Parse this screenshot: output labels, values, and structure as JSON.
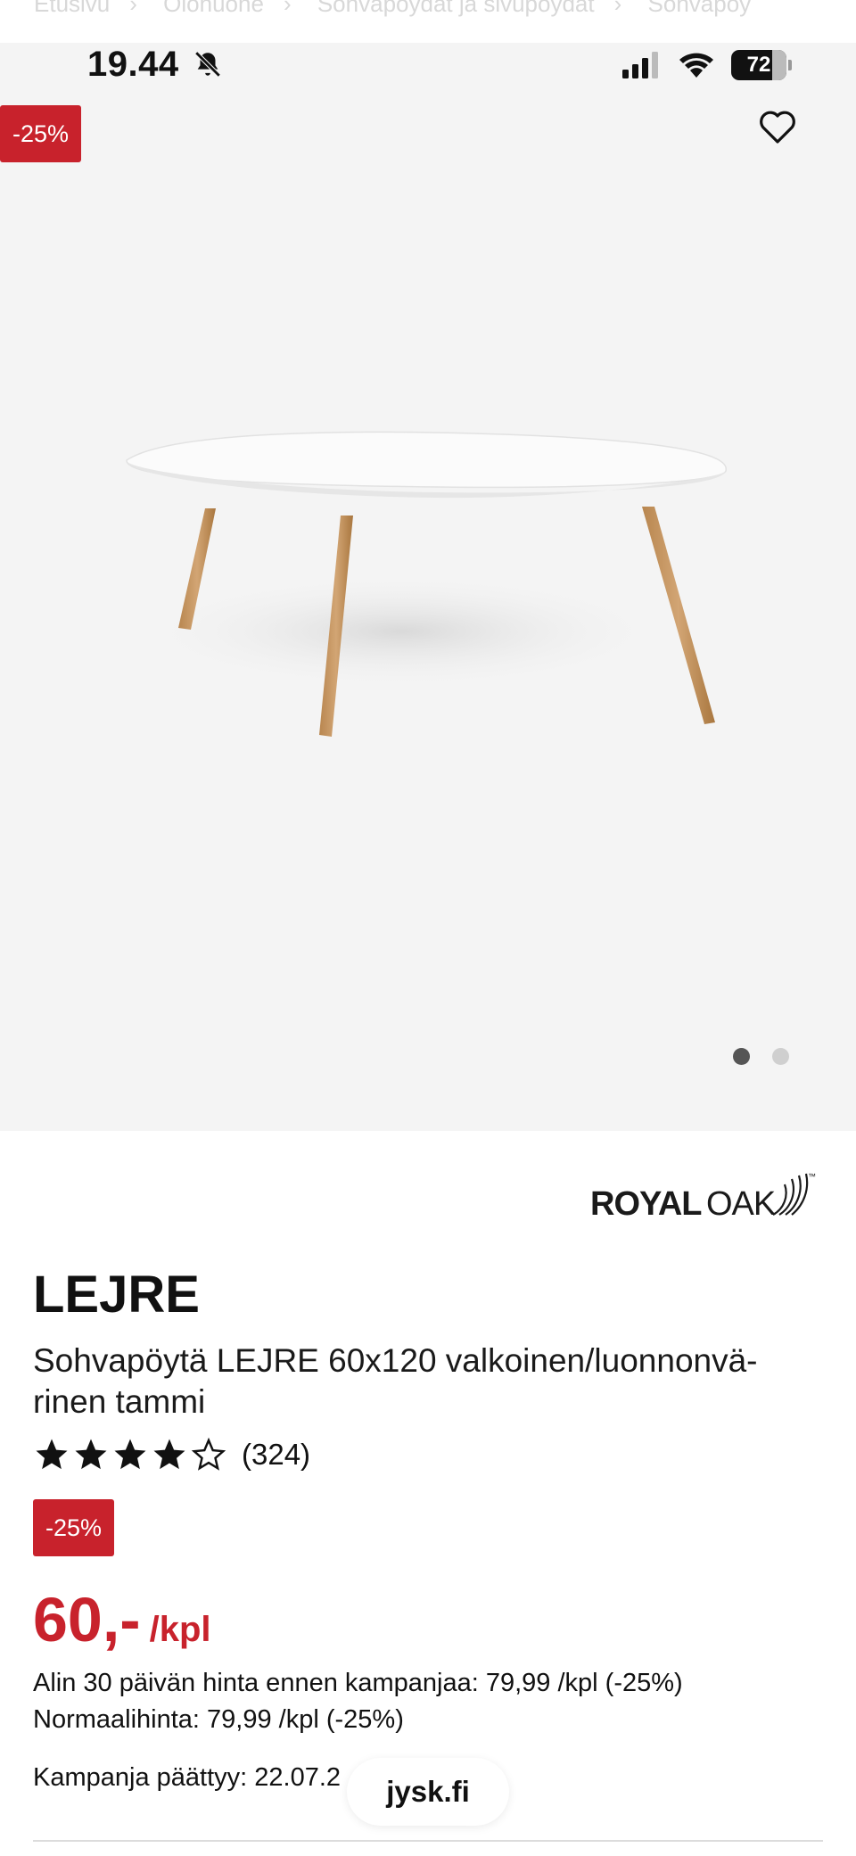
{
  "breadcrumb": [
    "Etusivu",
    "Olohuone",
    "Sohvapöydät ja sivupöydät",
    "Sohvapöy"
  ],
  "status_bar": {
    "time": "19.44",
    "battery": "72"
  },
  "gallery": {
    "discount_badge": "-25%",
    "slides_total": 2,
    "active_slide": 1
  },
  "brand": {
    "name": "ROYAL",
    "name2": "OAK",
    "tm": "™"
  },
  "product": {
    "name": "LEJRE",
    "description": "Sohvapöytä LEJRE 60x120 valkoinen/luonnonvä-rinen tammi",
    "rating": 4,
    "rating_max": 5,
    "rating_count": "(324)",
    "discount_badge": "-25%",
    "price": "60,-",
    "price_unit": "/kpl",
    "lowest_price_30d": "Alin 30 päivän hinta ennen kampanjaa: 79,99 /kpl (-25%)",
    "normal_price": "Normaalihinta: 79,99 /kpl (-25%)",
    "campaign_end": "Kampanja päättyy: 22.07.2"
  },
  "browser": {
    "url": "jysk.fi"
  },
  "colors": {
    "accent_red": "#c8222c",
    "gallery_bg": "#f4f4f4"
  }
}
